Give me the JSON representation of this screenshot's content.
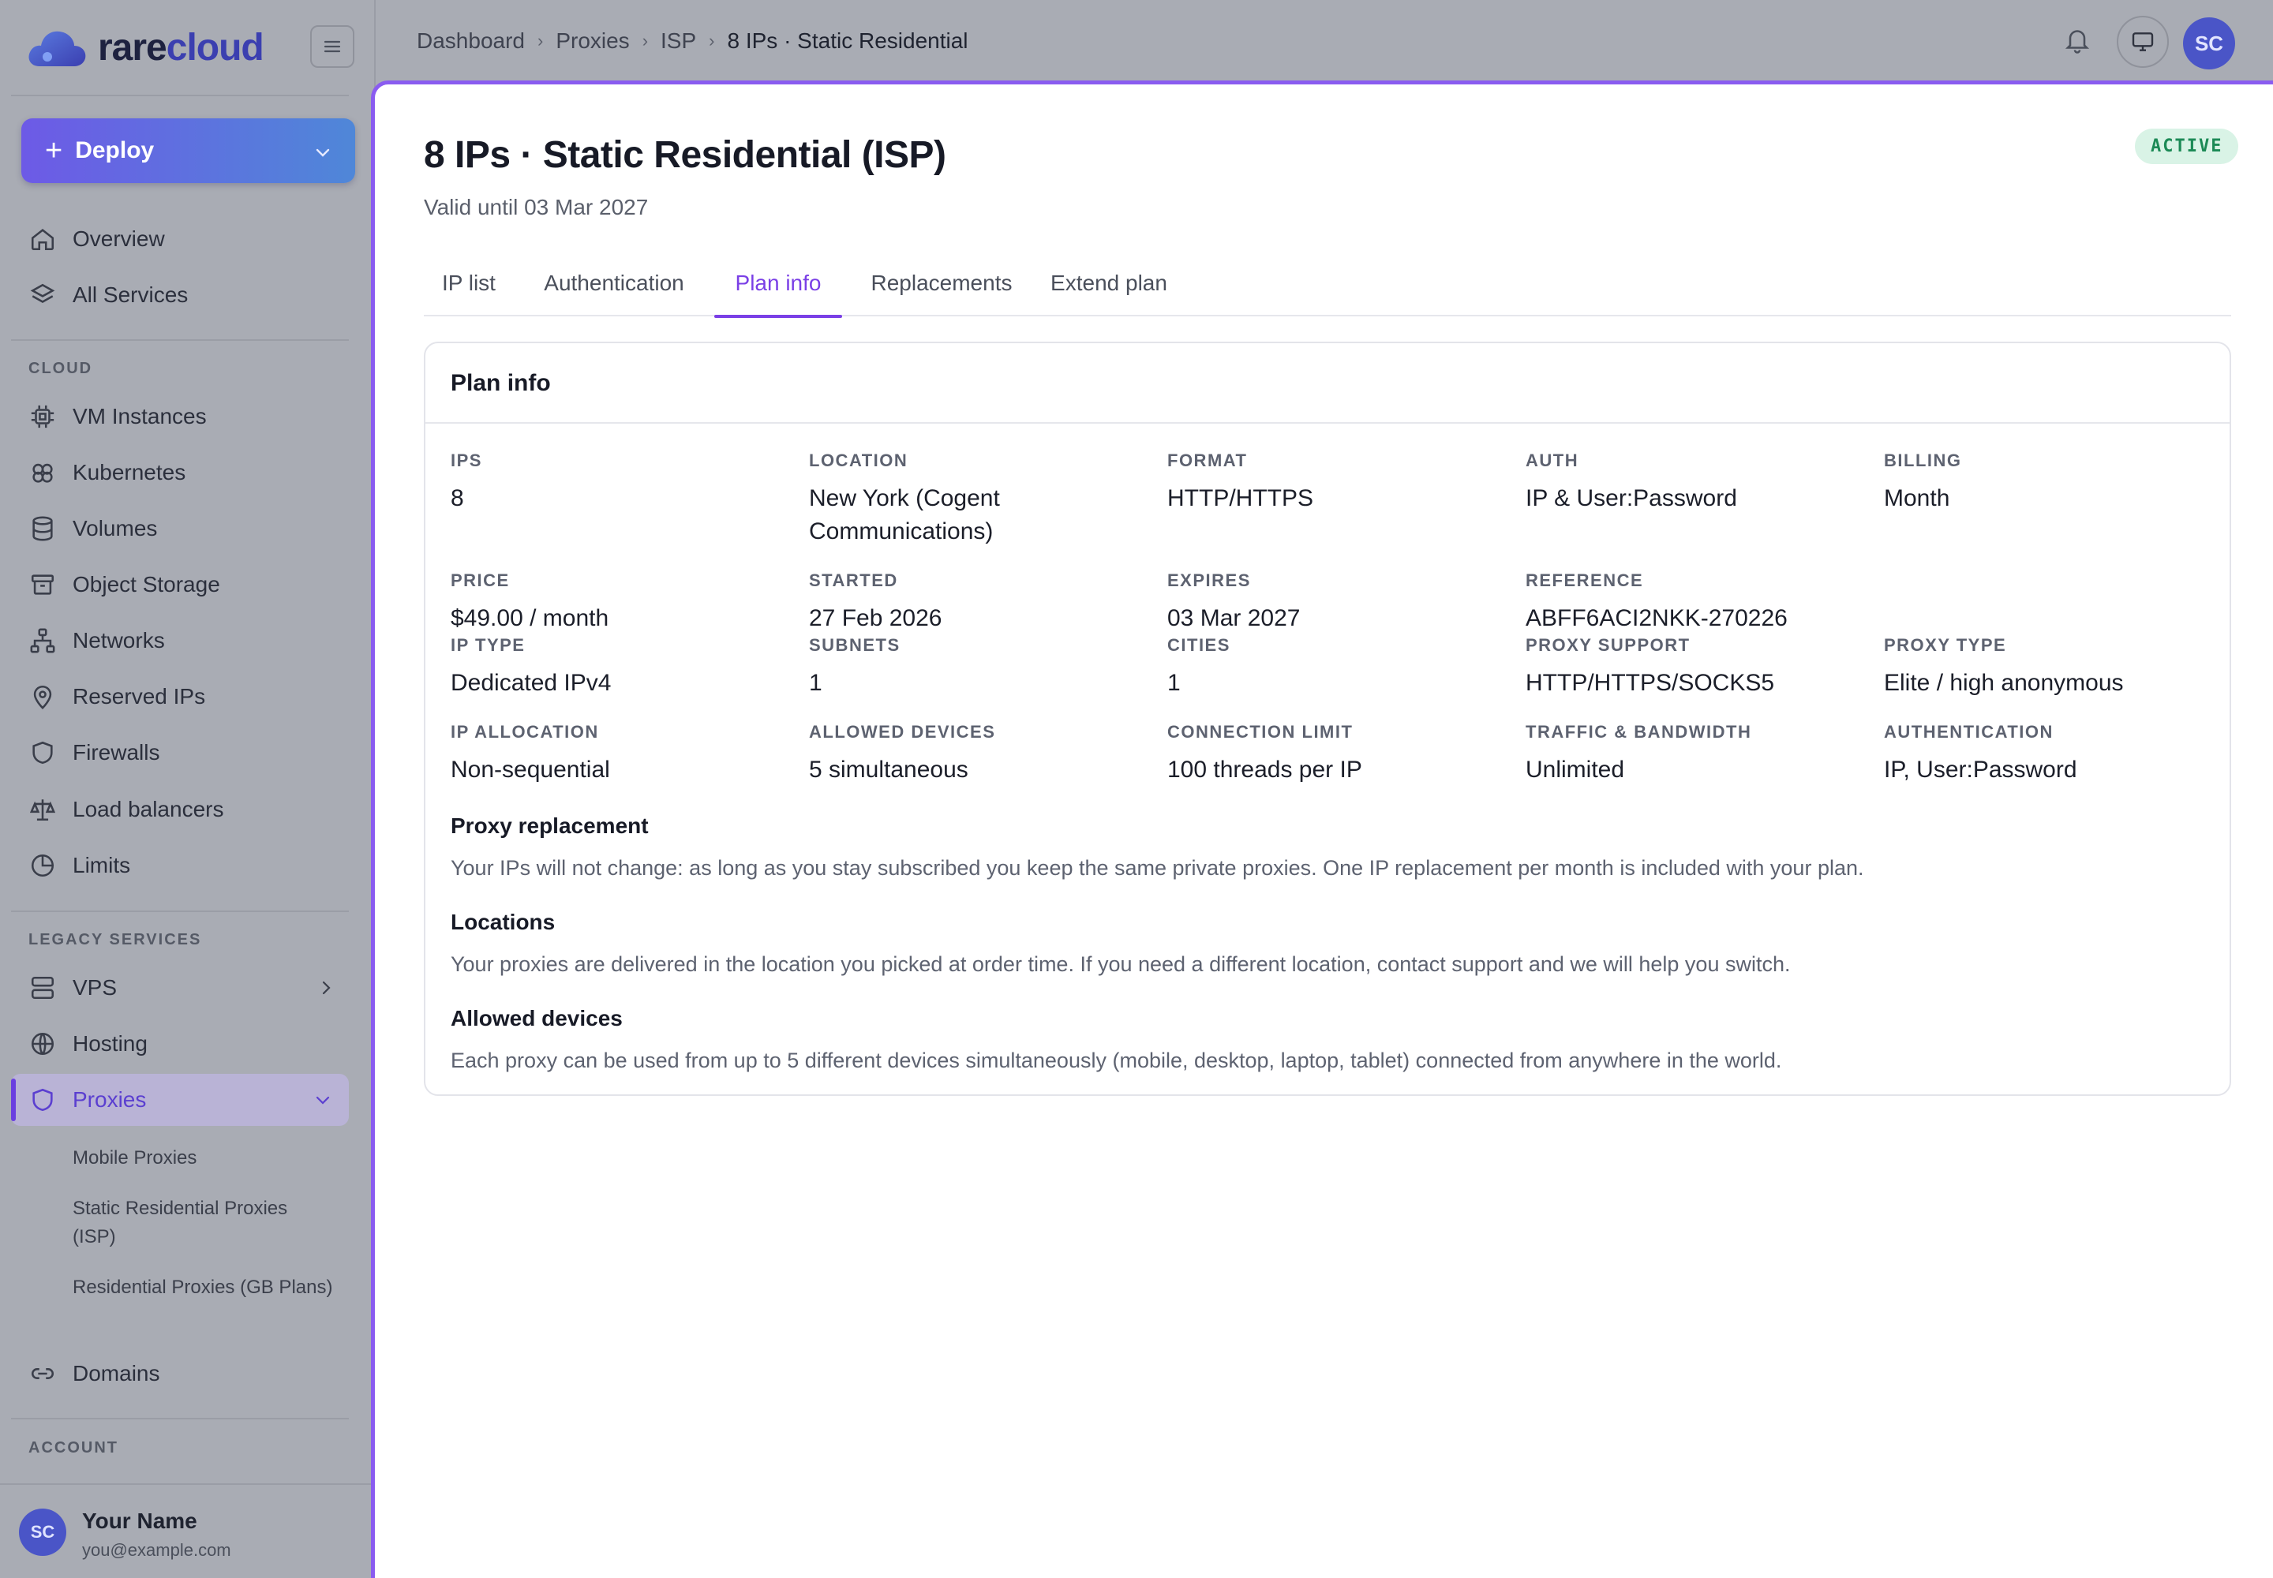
{
  "brand": {
    "name_a": "rare",
    "name_b": "cloud"
  },
  "sidebar": {
    "deploy_label": "Deploy",
    "top_items": [
      {
        "label": "Overview",
        "icon": "home-icon"
      },
      {
        "label": "All Services",
        "icon": "layers-icon"
      }
    ],
    "cloud_label": "CLOUD",
    "cloud_items": [
      {
        "label": "VM Instances",
        "icon": "cpu-icon"
      },
      {
        "label": "Kubernetes",
        "icon": "kubernetes-icon"
      },
      {
        "label": "Volumes",
        "icon": "database-icon"
      },
      {
        "label": "Object Storage",
        "icon": "archive-icon"
      },
      {
        "label": "Networks",
        "icon": "network-icon"
      },
      {
        "label": "Reserved IPs",
        "icon": "map-pin-icon"
      },
      {
        "label": "Firewalls",
        "icon": "shield-icon"
      },
      {
        "label": "Load balancers",
        "icon": "scale-icon"
      },
      {
        "label": "Limits",
        "icon": "pie-chart-icon"
      }
    ],
    "legacy_label": "LEGACY SERVICES",
    "legacy_items": [
      {
        "label": "VPS",
        "icon": "server-icon"
      },
      {
        "label": "Hosting",
        "icon": "globe-icon"
      },
      {
        "label": "Proxies",
        "icon": "shield-icon"
      }
    ],
    "proxy_sub": [
      "Mobile Proxies",
      "Static Residential Proxies (ISP)",
      "Residential Proxies (GB Plans)"
    ],
    "domains_label": "Domains",
    "account_label": "ACCOUNT",
    "user": {
      "initials": "SC",
      "name": "Your Name",
      "email": "you@example.com"
    }
  },
  "topbar": {
    "breadcrumbs": [
      "Dashboard",
      "Proxies",
      "ISP",
      "8 IPs · Static Residential"
    ],
    "avatar_initials": "SC"
  },
  "page": {
    "title": "8 IPs · Static Residential (ISP)",
    "subtitle": "Valid until 03 Mar 2027",
    "status": "ACTIVE",
    "tabs": [
      "IP list",
      "Authentication",
      "Plan info",
      "Replacements",
      "Extend plan"
    ],
    "active_tab": "Plan info"
  },
  "plan": {
    "title": "Plan info",
    "fields": [
      {
        "label": "IPS",
        "value": "8"
      },
      {
        "label": "LOCATION",
        "value": "New York (Cogent Communications)"
      },
      {
        "label": "FORMAT",
        "value": "HTTP/HTTPS"
      },
      {
        "label": "AUTH",
        "value": "IP & User:Password"
      },
      {
        "label": "BILLING",
        "value": "Month"
      },
      {
        "label": "PRICE",
        "value": "$49.00 / month"
      },
      {
        "label": "STARTED",
        "value": "27 Feb 2026"
      },
      {
        "label": "EXPIRES",
        "value": "03 Mar 2027"
      },
      {
        "label": "REFERENCE",
        "value": "ABFF6ACI2NKK-270226"
      },
      {
        "label": "IP TYPE",
        "value": "Dedicated IPv4"
      },
      {
        "label": "SUBNETS",
        "value": "1"
      },
      {
        "label": "CITIES",
        "value": "1"
      },
      {
        "label": "PROXY SUPPORT",
        "value": "HTTP/HTTPS/SOCKS5"
      },
      {
        "label": "PROXY TYPE",
        "value": "Elite / high anonymous"
      },
      {
        "label": "IP ALLOCATION",
        "value": "Non-sequential"
      },
      {
        "label": "ALLOWED DEVICES",
        "value": "5 simultaneous"
      },
      {
        "label": "CONNECTION LIMIT",
        "value": "100 threads per IP"
      },
      {
        "label": "TRAFFIC & BANDWIDTH",
        "value": "Unlimited"
      },
      {
        "label": "AUTHENTICATION",
        "value": "IP, User:Password"
      }
    ],
    "notes": [
      {
        "title": "Proxy replacement",
        "text": "Your IPs will not change: as long as you stay subscribed you keep the same private proxies. One IP replacement per month is included with your plan."
      },
      {
        "title": "Locations",
        "text": "Your proxies are delivered in the location you picked at order time. If you need a different location, contact support and we will help you switch."
      },
      {
        "title": "Allowed devices",
        "text": "Each proxy can be used from up to 5 different devices simultaneously (mobile, desktop, laptop, tablet) connected from anywhere in the world."
      }
    ]
  },
  "colors": {
    "accent": "#7a3fe6",
    "status_bg": "#d9f3e6",
    "status_fg": "#1c8a56",
    "deploy_from": "#6d5ae6",
    "deploy_to": "#4f87d8"
  }
}
